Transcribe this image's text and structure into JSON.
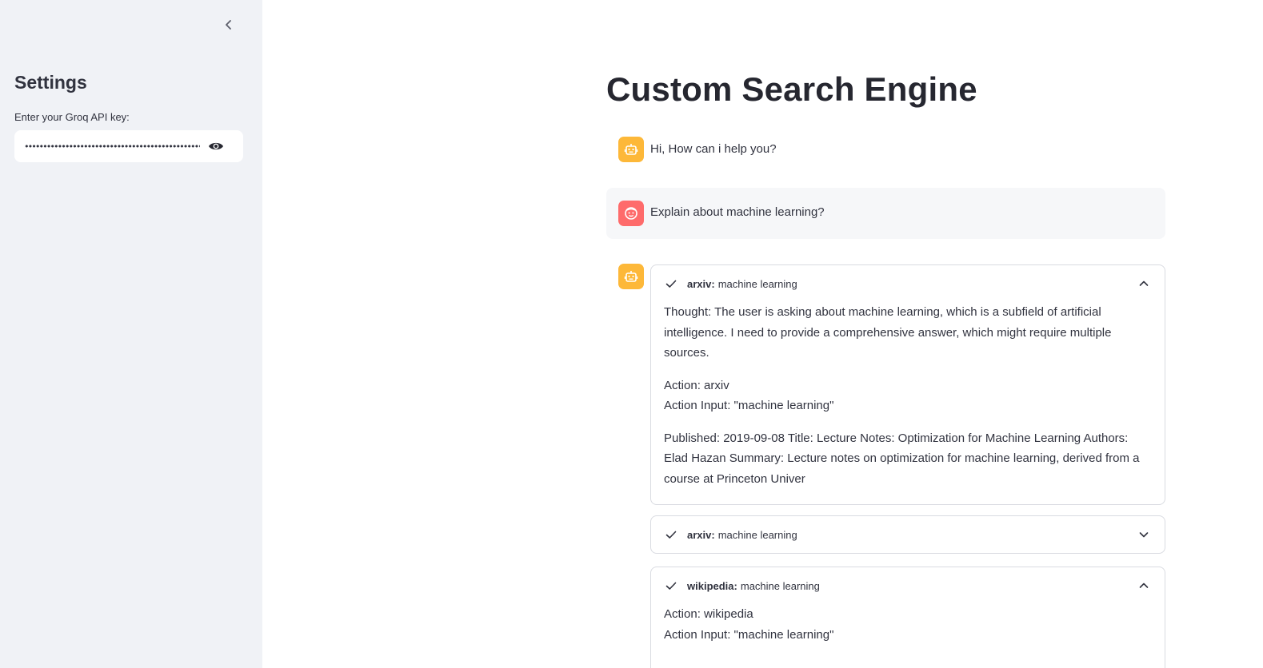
{
  "sidebar": {
    "title": "Settings",
    "api_label": "Enter your Groq API key:",
    "api_value": "••••••••••••••••••••••••••••••••••••••••••••••••••••••"
  },
  "main": {
    "title": "Custom Search Engine",
    "messages": [
      {
        "role": "assistant",
        "text": "Hi, How can i help you?"
      },
      {
        "role": "user",
        "text": "Explain about machine learning?"
      }
    ],
    "steps": [
      {
        "tool": "arxiv:",
        "query": "machine learning",
        "expanded": true,
        "paragraphs": [
          "Thought: The user is asking about machine learning, which is a subfield of artificial intelligence. I need to provide a comprehensive answer, which might require multiple sources.",
          "Action: arxiv",
          "Action Input: \"machine learning\"",
          "Published: 2019-09-08 Title: Lecture Notes: Optimization for Machine Learning Authors: Elad Hazan Summary: Lecture notes on optimization for machine learning, derived from a course at Princeton Univer"
        ]
      },
      {
        "tool": "arxiv:",
        "query": "machine learning",
        "expanded": false
      },
      {
        "tool": "wikipedia:",
        "query": "machine learning",
        "expanded": true,
        "paragraphs": [
          "Action: wikipedia",
          "Action Input: \"machine learning\""
        ]
      }
    ]
  },
  "colors": {
    "sidebar_bg": "#f0f2f6",
    "bot_avatar": "#fdb839",
    "user_avatar": "#fe6b6b"
  }
}
